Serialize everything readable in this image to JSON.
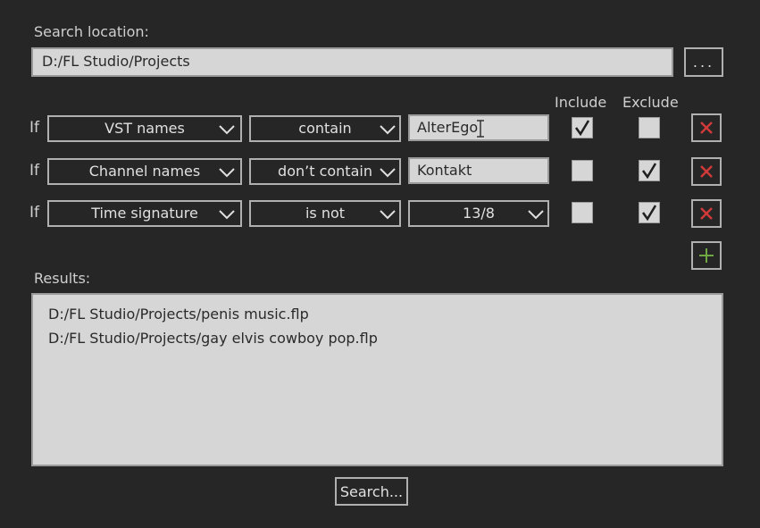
{
  "search": {
    "label": "Search location:",
    "path": "D:/FL Studio/Projects",
    "browse_label": "..."
  },
  "columns": {
    "include": "Include",
    "exclude": "Exclude"
  },
  "filters": [
    {
      "if_label": "If",
      "field": "VST names",
      "operator": "contain",
      "value": "AlterEgo",
      "value_type": "text",
      "include": true,
      "exclude": false
    },
    {
      "if_label": "If",
      "field": "Channel names",
      "operator": "don’t contain",
      "value": "Kontakt",
      "value_type": "text",
      "include": false,
      "exclude": true
    },
    {
      "if_label": "If",
      "field": "Time signature",
      "operator": "is not",
      "value": "13/8",
      "value_type": "dropdown",
      "include": false,
      "exclude": true
    }
  ],
  "results": {
    "label": "Results:",
    "items": [
      "D:/FL Studio/Projects/penis music.flp",
      "D:/FL Studio/Projects/gay elvis cowboy pop.flp"
    ]
  },
  "search_button_label": "Search...",
  "icons": {
    "remove": "close-x-icon",
    "add": "plus-icon",
    "dropdown": "chevron-down-icon",
    "check": "checkmark-icon"
  },
  "colors": {
    "background": "#262626",
    "field": "#d6d6d6",
    "remove": "#d03a3a",
    "add": "#6fa843"
  }
}
